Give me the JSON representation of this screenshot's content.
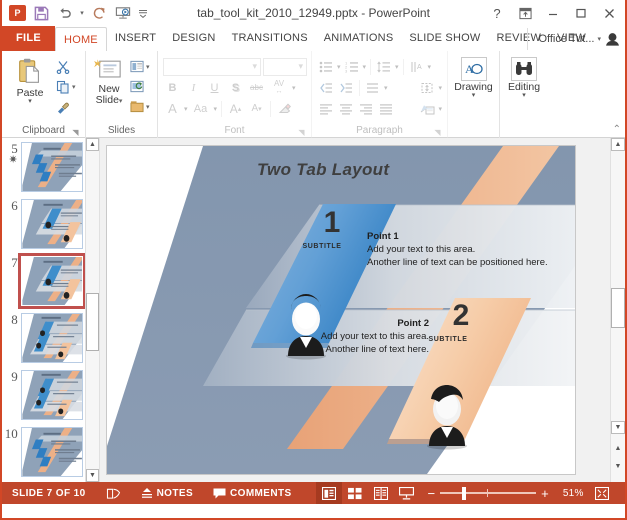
{
  "window": {
    "title": "tab_tool_kit_2010_12949.pptx - PowerPoint",
    "app_logo": "P",
    "quick_access": [
      {
        "name": "save-icon",
        "label": "Save"
      },
      {
        "name": "undo-icon",
        "label": "Undo"
      },
      {
        "name": "redo-icon",
        "label": "Redo"
      },
      {
        "name": "start-slideshow-icon",
        "label": "Start From Beginning"
      },
      {
        "name": "customize-qat-icon",
        "label": "Customize Quick Access Toolbar"
      }
    ],
    "controls": {
      "help": "?",
      "ribbon_display": "Ribbon Display Options",
      "minimize": "Minimize",
      "maximize": "Restore Down",
      "close": "Close"
    },
    "accent_color": "#d24726",
    "status_color": "#c0472b"
  },
  "tabs": {
    "file": "FILE",
    "items": [
      {
        "label": "HOME",
        "active": true
      },
      {
        "label": "INSERT",
        "active": false
      },
      {
        "label": "DESIGN",
        "active": false
      },
      {
        "label": "TRANSITIONS",
        "active": false
      },
      {
        "label": "ANIMATIONS",
        "active": false
      },
      {
        "label": "SLIDE SHOW",
        "active": false
      },
      {
        "label": "REVIEW",
        "active": false
      },
      {
        "label": "VIEW",
        "active": false
      }
    ],
    "account": "Office Tut..."
  },
  "ribbon": {
    "groups": [
      {
        "name": "clipboard",
        "label": "Clipboard",
        "paste": "Paste",
        "items": [
          "Cut",
          "Copy",
          "Format Painter"
        ]
      },
      {
        "name": "slides",
        "label": "Slides",
        "new_slide_line1": "New",
        "new_slide_line2": "Slide",
        "items": [
          "Layout",
          "Reset",
          "Section"
        ]
      },
      {
        "name": "font",
        "label": "Font",
        "font_name_value": "",
        "font_size_value": "",
        "bold": "B",
        "italic": "I",
        "underline": "U",
        "shadow": "S",
        "strikethrough": "abc",
        "char_spacing": "AV",
        "text_color": "A",
        "change_case": "Aa",
        "increase_size": "A",
        "decrease_size": "A",
        "clear_formatting": "Clear All Formatting"
      },
      {
        "name": "paragraph",
        "label": "Paragraph",
        "items": [
          "Bullets",
          "Numbering",
          "Line Spacing",
          "Text Direction",
          "Decrease Indent",
          "Increase Indent",
          "Columns",
          "Align Text",
          "Align Left",
          "Center",
          "Align Right",
          "Justify",
          "Convert to SmartArt"
        ]
      },
      {
        "name": "drawing",
        "label": "Drawing",
        "button": "Drawing"
      },
      {
        "name": "editing",
        "label": "Editing",
        "button": "Editing"
      }
    ],
    "collapse": "Collapse the Ribbon"
  },
  "thumbnails": {
    "items": [
      {
        "number": "5",
        "starred": true,
        "selected": false,
        "style": "list"
      },
      {
        "number": "6",
        "starred": false,
        "selected": false,
        "style": "two-tab"
      },
      {
        "number": "7",
        "starred": false,
        "selected": true,
        "style": "two-tab"
      },
      {
        "number": "8",
        "starred": false,
        "selected": false,
        "style": "three-tab"
      },
      {
        "number": "9",
        "starred": false,
        "selected": false,
        "style": "three-tab"
      },
      {
        "number": "10",
        "starred": false,
        "selected": false,
        "style": "list"
      }
    ]
  },
  "slide": {
    "title": "Two Tab Layout",
    "tabs": [
      {
        "number": "1",
        "subtitle": "SUBTITLE",
        "heading": "Point 1",
        "line1": "Add your text to this area.",
        "line2": "Another line of text can be positioned here.",
        "color": "#3f7fbf"
      },
      {
        "number": "2",
        "subtitle": "SUBTITLE",
        "heading": "Point 2",
        "line1": "Add your text to this area.",
        "line2": "Another line of text here.",
        "color": "#f2bd94"
      }
    ],
    "background_band_blue": "#7f93ad",
    "background_band_orange": "#eeaf82"
  },
  "status": {
    "slide_indicator": "SLIDE 7 OF 10",
    "language_icon": "language-icon",
    "notes": "NOTES",
    "comments": "COMMENTS",
    "views": [
      {
        "name": "normal-view",
        "active": true
      },
      {
        "name": "slide-sorter-view",
        "active": false
      },
      {
        "name": "reading-view",
        "active": false
      },
      {
        "name": "slide-show-view",
        "active": false
      }
    ],
    "zoom_out": "−",
    "zoom_in": "+",
    "zoom_level": "51%",
    "fit_to_window": "fit-slide-icon"
  }
}
